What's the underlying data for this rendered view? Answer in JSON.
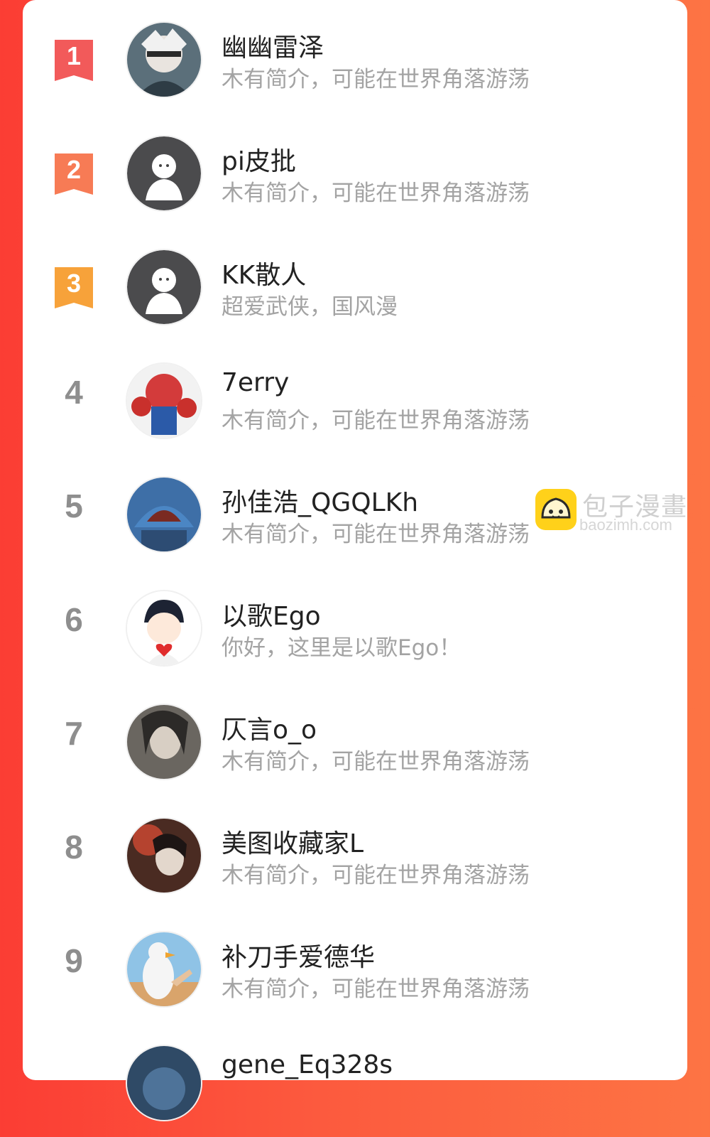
{
  "theme": {
    "accent": "#fb3d34",
    "rank1": "#f25a5a",
    "rank2": "#f77b55",
    "rank3": "#f7a23a",
    "rank_gray": "#8e8e8e"
  },
  "users": [
    {
      "rank": "1",
      "name": "幽幽雷泽",
      "bio": "木有简介，可能在世界角落游荡",
      "avatar": "anime-avatar-icon"
    },
    {
      "rank": "2",
      "name": "pi皮批",
      "bio": "木有简介，可能在世界角落游荡",
      "avatar": "default-avatar-icon"
    },
    {
      "rank": "3",
      "name": "KK散人",
      "bio": "超爱武侠，国风漫",
      "avatar": "default-avatar-icon"
    },
    {
      "rank": "4",
      "name": "7erry",
      "bio": "木有简介，可能在世界角落游荡",
      "avatar": "spiderman-avatar-icon"
    },
    {
      "rank": "5",
      "name": "孙佳浩_QGQLKh",
      "bio": "木有简介，可能在世界角落游荡",
      "avatar": "shark-avatar-icon"
    },
    {
      "rank": "6",
      "name": "以歌Ego",
      "bio": "你好，这里是以歌Ego！",
      "avatar": "cartoon-heart-avatar-icon"
    },
    {
      "rank": "7",
      "name": "仄言o_o",
      "bio": "木有简介，可能在世界角落游荡",
      "avatar": "dark-anime-avatar-icon"
    },
    {
      "rank": "8",
      "name": "美图收藏家L",
      "bio": "木有简介，可能在世界角落游荡",
      "avatar": "illustration-avatar-icon"
    },
    {
      "rank": "9",
      "name": "补刀手爱德华",
      "bio": "木有简介，可能在世界角落游荡",
      "avatar": "duck-avatar-icon"
    },
    {
      "rank": "",
      "name": "gene_Eq328s",
      "bio": "",
      "avatar": "partial-avatar-icon"
    }
  ],
  "watermark": {
    "title": "包子漫畫",
    "url": "baozimh.com",
    "icon": "bun-logo-icon"
  }
}
